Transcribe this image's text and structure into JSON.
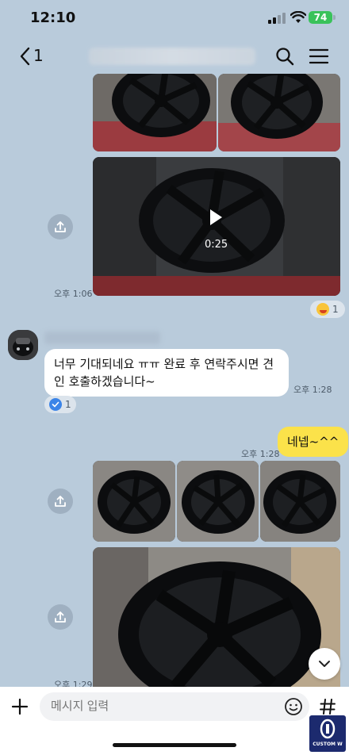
{
  "status_bar": {
    "time": "12:10",
    "battery": "74"
  },
  "header": {
    "back_count": "1"
  },
  "messages": {
    "video_time": "오후 1:06",
    "video_duration": "0:25",
    "reaction_count_1": "1",
    "incoming_text": "너무 기대되네요 ㅠㅠ 완료 후 연락주시면 견인 호출하겠습니다~",
    "incoming_time": "오후 1:28",
    "reaction_count_2": "1",
    "reply_time": "오후 1:28",
    "reply_text": "네넵~^^",
    "last_time": "오후 1:29"
  },
  "input": {
    "placeholder": "메시지 입력"
  },
  "watermark": {
    "text": "CUSTOM W"
  },
  "colors": {
    "background": "#b9cbdb",
    "my_bubble": "#fbe24a",
    "battery": "#39c25a"
  },
  "icons": [
    "back-icon",
    "search-icon",
    "menu-icon",
    "share-icon",
    "play-icon",
    "emoji-reaction-icon",
    "check-reaction-icon",
    "plus-icon",
    "emoji-icon",
    "hash-icon",
    "chevron-down-icon"
  ]
}
